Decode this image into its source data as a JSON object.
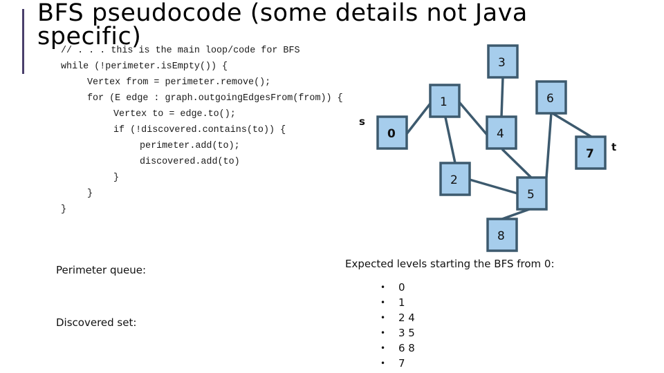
{
  "slide": {
    "title": "BFS pseudocode (some details not Java specific)",
    "accent_color": "#4a3f6b"
  },
  "code": {
    "lines": [
      {
        "indent": 0,
        "text": "// . . . this is the main loop/code for BFS"
      },
      {
        "indent": 0,
        "text": "while (!perimeter.isEmpty()) {"
      },
      {
        "indent": 1,
        "text": "Vertex from = perimeter.remove();"
      },
      {
        "indent": 1,
        "text": "for (E edge : graph.outgoingEdgesFrom(from)) {"
      },
      {
        "indent": 2,
        "text": "Vertex to = edge.to();"
      },
      {
        "indent": 2,
        "text": "if (!discovered.contains(to)) {"
      },
      {
        "indent": 3,
        "text": "perimeter.add(to);"
      },
      {
        "indent": 3,
        "text": "discovered.add(to)"
      },
      {
        "indent": 2,
        "text": "}"
      },
      {
        "indent": 1,
        "text": "}"
      },
      {
        "indent": 0,
        "text": "}"
      }
    ]
  },
  "graph": {
    "node_fill": "#a6cdec",
    "node_border": "#3d5a6e",
    "nodes": [
      {
        "id": "0",
        "label": "0",
        "bold": true
      },
      {
        "id": "1",
        "label": "1",
        "bold": false
      },
      {
        "id": "2",
        "label": "2",
        "bold": false
      },
      {
        "id": "3",
        "label": "3",
        "bold": false
      },
      {
        "id": "4",
        "label": "4",
        "bold": false
      },
      {
        "id": "5",
        "label": "5",
        "bold": false
      },
      {
        "id": "6",
        "label": "6",
        "bold": false
      },
      {
        "id": "7",
        "label": "7",
        "bold": true
      },
      {
        "id": "8",
        "label": "8",
        "bold": false
      }
    ],
    "edges": [
      [
        "0",
        "1"
      ],
      [
        "1",
        "4"
      ],
      [
        "1",
        "2"
      ],
      [
        "3",
        "4"
      ],
      [
        "4",
        "5"
      ],
      [
        "6",
        "5"
      ],
      [
        "6",
        "7"
      ],
      [
        "2",
        "5"
      ],
      [
        "5",
        "8"
      ]
    ],
    "source_marker": {
      "label": "s",
      "node": "0"
    },
    "target_marker": {
      "label": "t",
      "node": "7"
    }
  },
  "state": {
    "perimeter_label": "Perimeter queue:",
    "discovered_label": "Discovered set:"
  },
  "levels": {
    "title": "Expected levels starting the BFS from 0:",
    "bullet": "•",
    "items": [
      "0",
      "1",
      "2 4",
      "3 5",
      "6 8",
      "7"
    ]
  }
}
